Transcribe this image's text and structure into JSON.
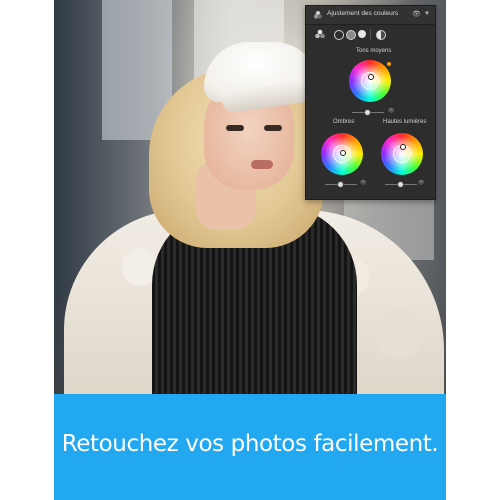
{
  "panel": {
    "title": "Ajustement des couleurs",
    "icon": "color-grading-icon",
    "visibility_icon": "eye-icon",
    "menu_icon": "chevron-down-icon",
    "modes": [
      "all",
      "shadows",
      "midtones",
      "highlights",
      "global"
    ],
    "sections": {
      "midtones": {
        "label": "Tons moyens"
      },
      "shadows": {
        "label": "Ombres"
      },
      "highlights": {
        "label": "Hautes lumières"
      }
    }
  },
  "banner": {
    "text": "Retouchez vos photos facilement.",
    "color": "#22a8f0"
  }
}
